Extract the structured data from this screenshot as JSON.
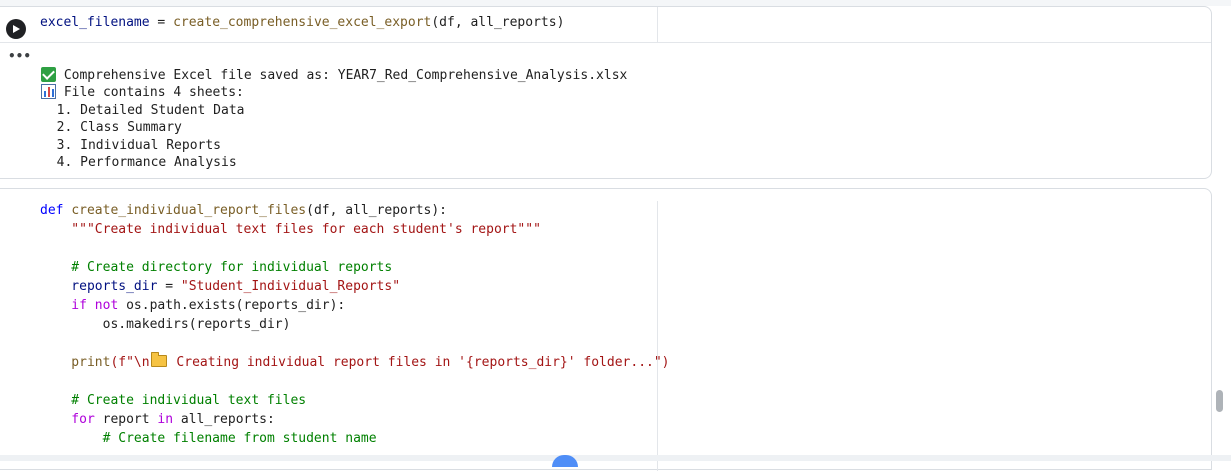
{
  "cell1": {
    "code": {
      "var": "excel_filename",
      "op": " = ",
      "fn": "create_comprehensive_excel_export",
      "args": "(df, all_reports)"
    },
    "output": {
      "line1": "Comprehensive Excel file saved as: YEAR7_Red_Comprehensive_Analysis.xlsx",
      "line2": "File contains 4 sheets:",
      "sheets": [
        "  1. Detailed Student Data",
        "  2. Class Summary",
        "  3. Individual Reports",
        "  4. Performance Analysis"
      ]
    },
    "output_menu": "•••"
  },
  "cell2": {
    "l1": {
      "kw": "def",
      "fn": "create_individual_report_files",
      "args": "(df, all_reports):"
    },
    "l2": "    \"\"\"Create individual text files for each student's report\"\"\"",
    "l4": "    # Create directory for individual reports",
    "l5": {
      "var": "    reports_dir",
      "op": " = ",
      "str": "\"Student_Individual_Reports\""
    },
    "l6": {
      "kw": "    if not",
      "rest": " os.path.exists(reports_dir):"
    },
    "l7": "        os.makedirs(reports_dir)",
    "l9": {
      "fn": "    print",
      "pre": "(f\"\\n",
      "post": " Creating individual report files in '{reports_dir}' folder...\")"
    },
    "l11": "    # Create individual text files",
    "l12": {
      "kw": "    for",
      "mid": " report ",
      "kw2": "in",
      "rest": " all_reports:"
    },
    "l13": "        # Create filename from student name"
  },
  "icons": [
    "run-icon",
    "check-icon",
    "bar-chart-icon",
    "folder-icon"
  ],
  "colors": {
    "keyword": "#0000ff",
    "control": "#af00db",
    "function": "#795e26",
    "string": "#a31515",
    "comment": "#008000",
    "success": "#2ea043"
  }
}
